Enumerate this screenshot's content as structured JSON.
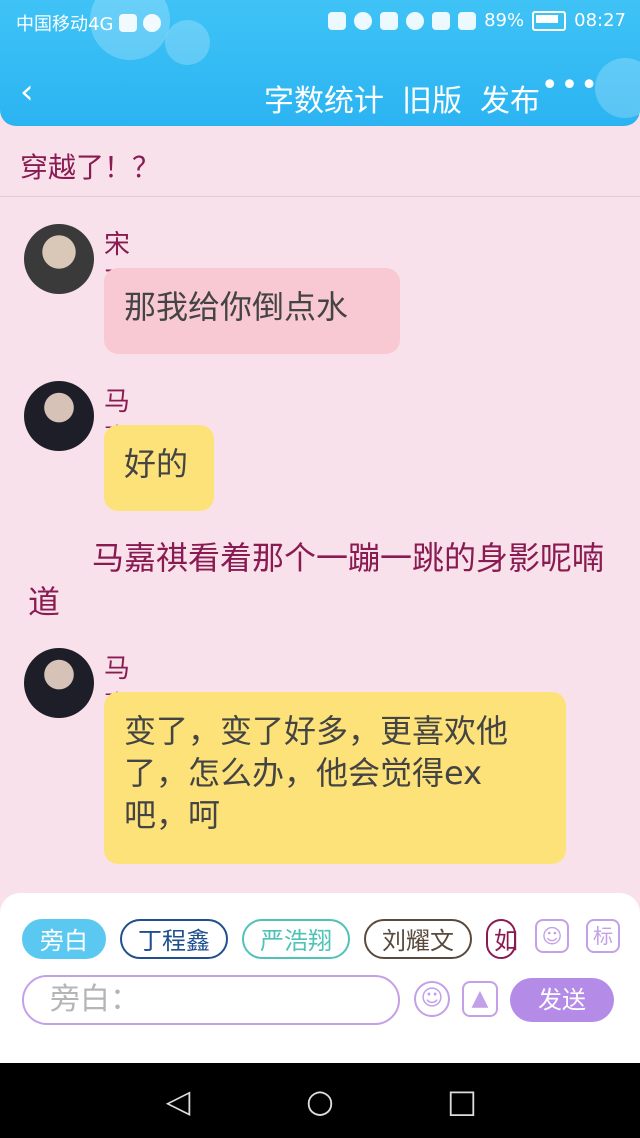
{
  "status_bar": {
    "carrier": "中国移动4G",
    "battery": "89%",
    "time": "08:27"
  },
  "app_bar": {
    "back_icon": "chevron-left-icon",
    "actions": [
      "字数统计",
      "旧版",
      "发布"
    ],
    "more_icon": "more-dots-icon"
  },
  "chapter_title": "穿越了！？",
  "messages": [
    {
      "name": "宋亚轩",
      "text": "那我给你倒点水"
    },
    {
      "name": "马嘉祺",
      "text": "好的"
    },
    {
      "narration": "马嘉祺看着那个一蹦一跳的身影呢喃道"
    },
    {
      "name": "马嘉祺",
      "text": "变了，变了好多，更喜欢他了，怎么办，他会觉得ex吧，呵"
    }
  ],
  "composer": {
    "chips": [
      "旁白",
      "丁程鑫",
      "严浩翔",
      "刘耀文",
      "如"
    ],
    "tool_icons": [
      "person-icon",
      "tag-icon"
    ],
    "tag_label": "标",
    "input_placeholder": "旁白：",
    "emoji_icon": "emoji-icon",
    "image_icon": "image-icon",
    "send_label": "发送"
  },
  "colors": {
    "header": "#2bb4f2",
    "background": "#f8e1ea",
    "pink_bubble": "#f9c9d3",
    "yellow_bubble": "#fde27a",
    "accent_purple": "#b58be8",
    "name_text": "#8a1b52"
  }
}
